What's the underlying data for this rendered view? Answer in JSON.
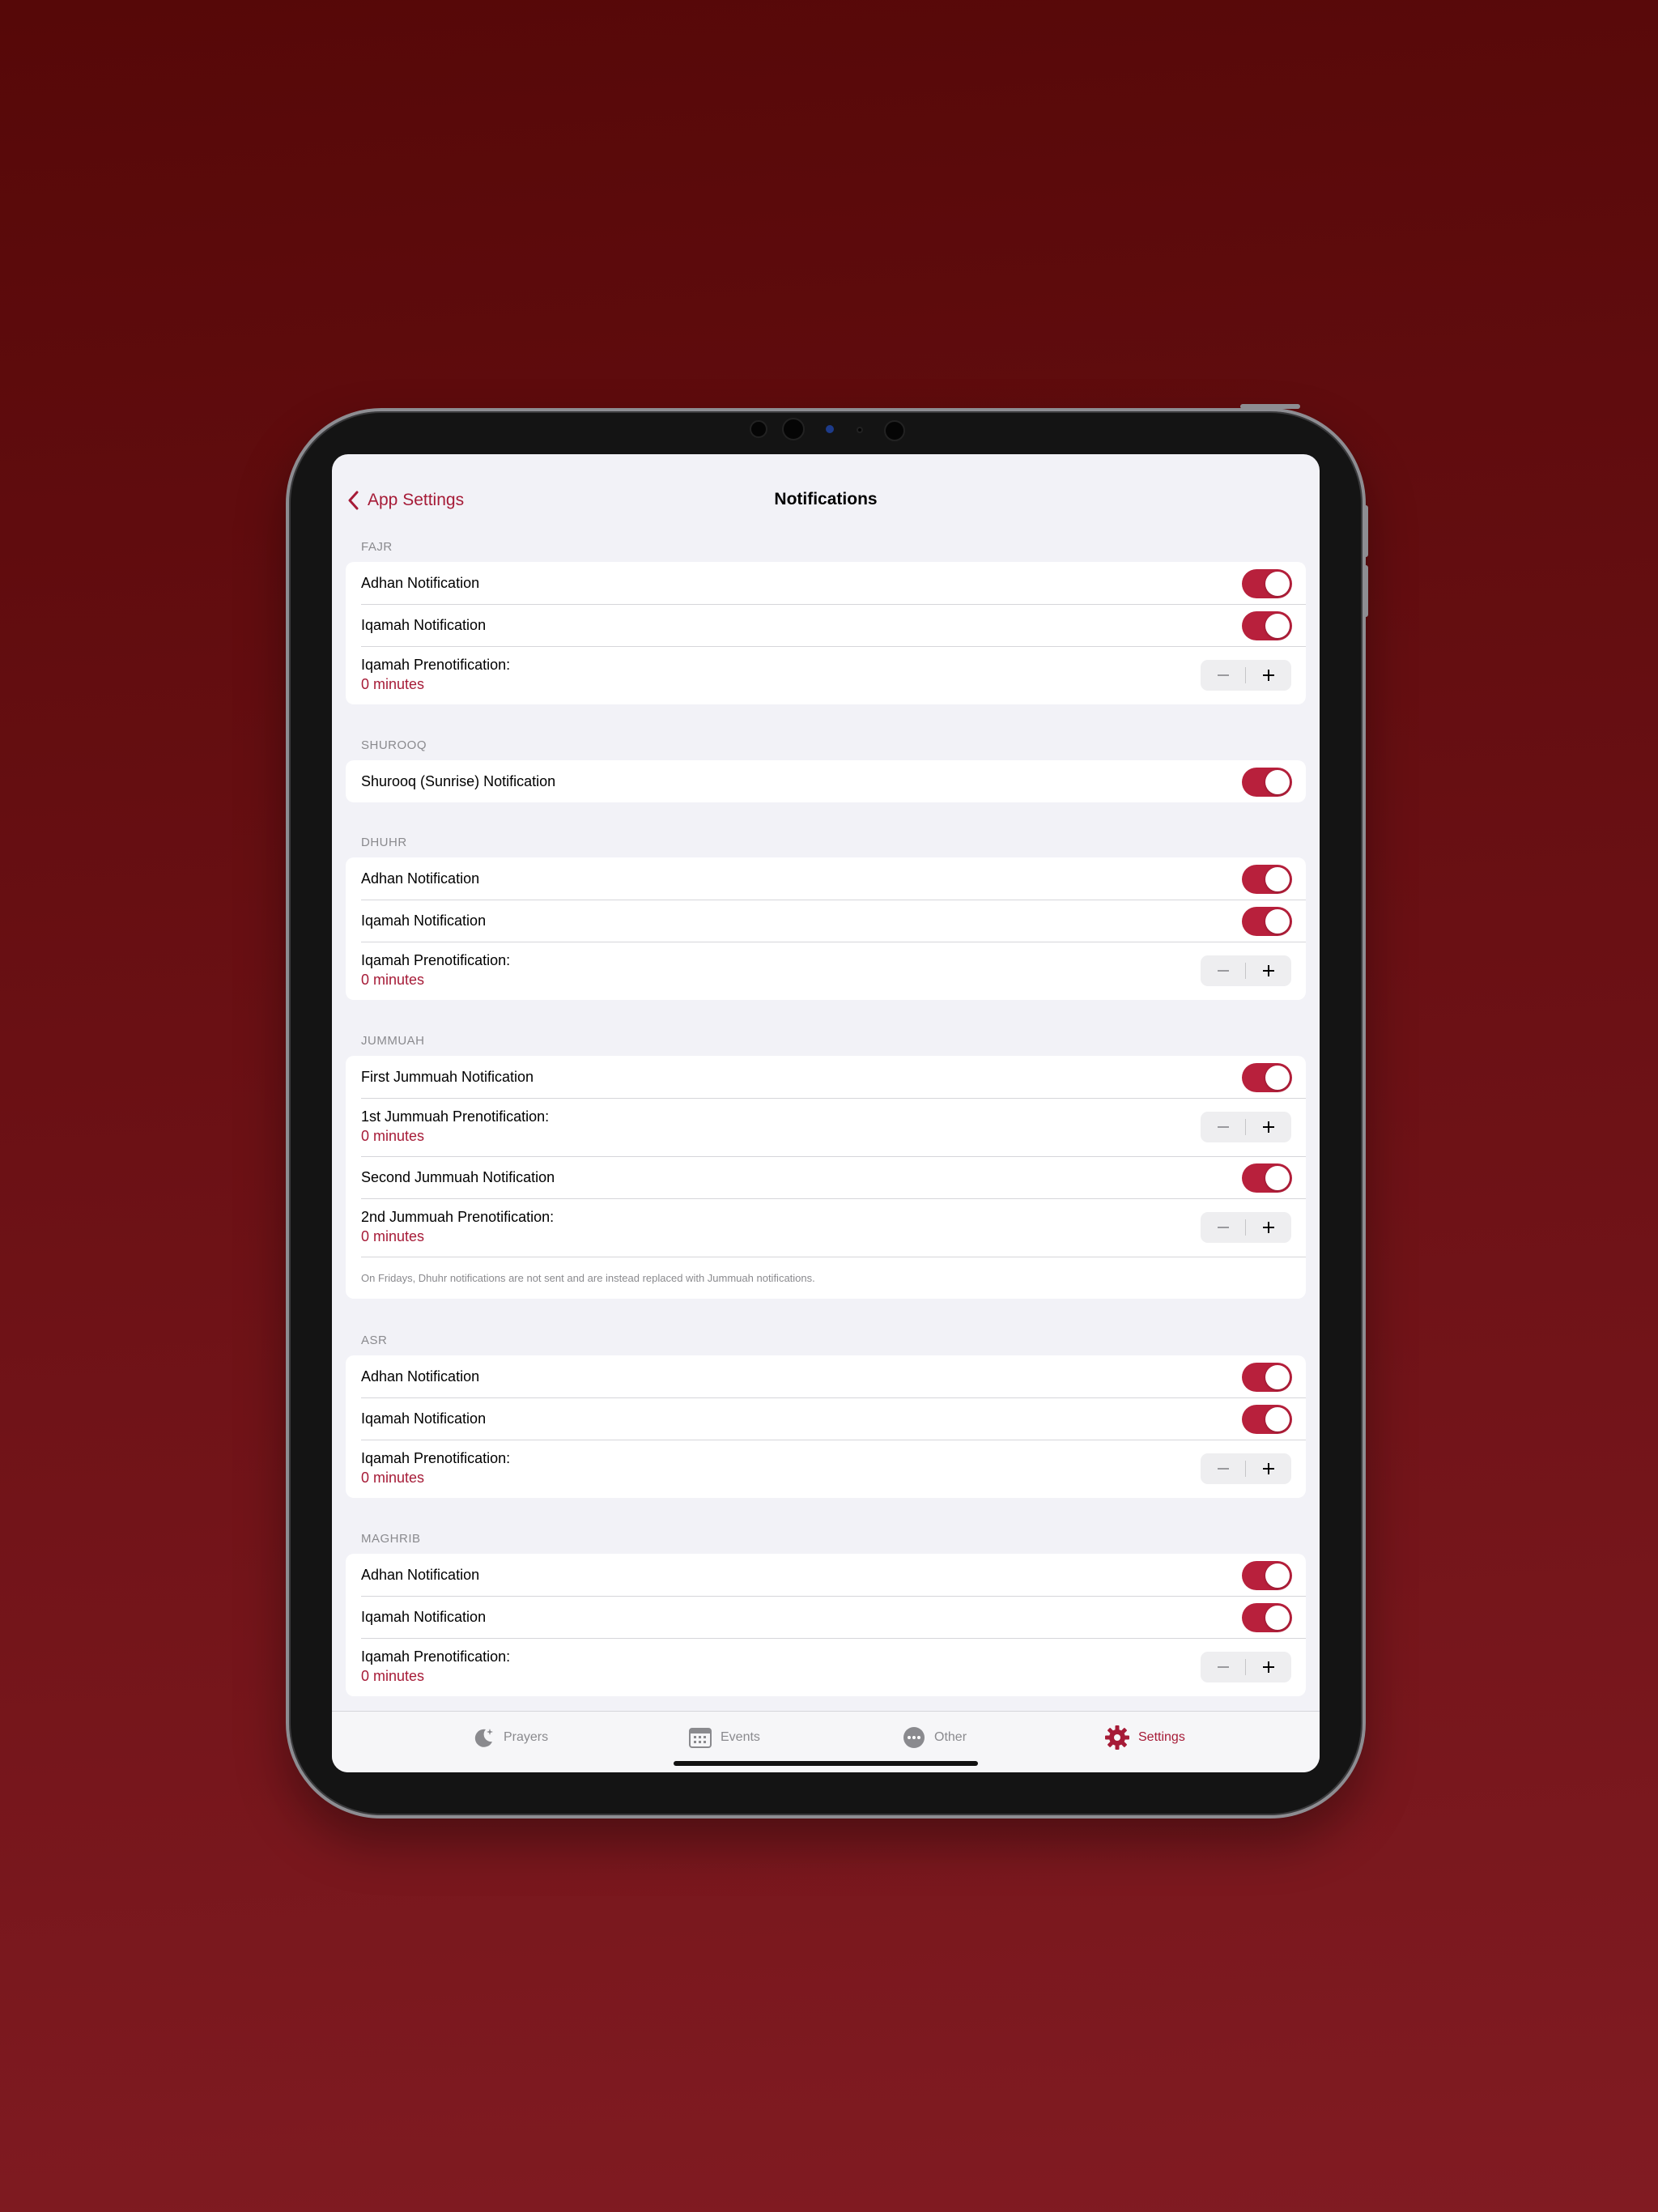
{
  "nav": {
    "back_label": "App Settings",
    "title": "Notifications"
  },
  "colors": {
    "accent": "#a61b37",
    "toggle_on": "#b8203c"
  },
  "sections": {
    "fajr": {
      "header": "FAJR",
      "rows": [
        {
          "label": "Adhan Notification",
          "on": true
        },
        {
          "label": "Iqamah Notification",
          "on": true
        },
        {
          "label": "Iqamah Prenotification:",
          "value": "0 minutes"
        }
      ]
    },
    "shurooq": {
      "header": "SHUROOQ",
      "rows": [
        {
          "label": "Shurooq (Sunrise) Notification",
          "on": true
        }
      ]
    },
    "dhuhr": {
      "header": "DHUHR",
      "rows": [
        {
          "label": "Adhan Notification",
          "on": true
        },
        {
          "label": "Iqamah Notification",
          "on": true
        },
        {
          "label": "Iqamah Prenotification:",
          "value": "0 minutes"
        }
      ]
    },
    "jummuah": {
      "header": "JUMMUAH",
      "rows": [
        {
          "label": "First Jummuah Notification",
          "on": true
        },
        {
          "label": "1st Jummuah Prenotification:",
          "value": "0 minutes"
        },
        {
          "label": "Second Jummuah Notification",
          "on": true
        },
        {
          "label": "2nd Jummuah Prenotification:",
          "value": "0 minutes"
        }
      ],
      "footer": "On Fridays, Dhuhr notifications are not sent and are instead replaced with Jummuah notifications."
    },
    "asr": {
      "header": "ASR",
      "rows": [
        {
          "label": "Adhan Notification",
          "on": true
        },
        {
          "label": "Iqamah Notification",
          "on": true
        },
        {
          "label": "Iqamah Prenotification:",
          "value": "0 minutes"
        }
      ]
    },
    "maghrib": {
      "header": "MAGHRIB",
      "rows": [
        {
          "label": "Adhan Notification",
          "on": true
        },
        {
          "label": "Iqamah Notification",
          "on": true
        },
        {
          "label": "Iqamah Prenotification:",
          "value": "0 minutes"
        }
      ]
    }
  },
  "tabs": [
    {
      "label": "Prayers",
      "icon": "moon-stars-icon",
      "active": false
    },
    {
      "label": "Events",
      "icon": "calendar-icon",
      "active": false
    },
    {
      "label": "Other",
      "icon": "ellipsis-circle-icon",
      "active": false
    },
    {
      "label": "Settings",
      "icon": "gear-icon",
      "active": true
    }
  ]
}
